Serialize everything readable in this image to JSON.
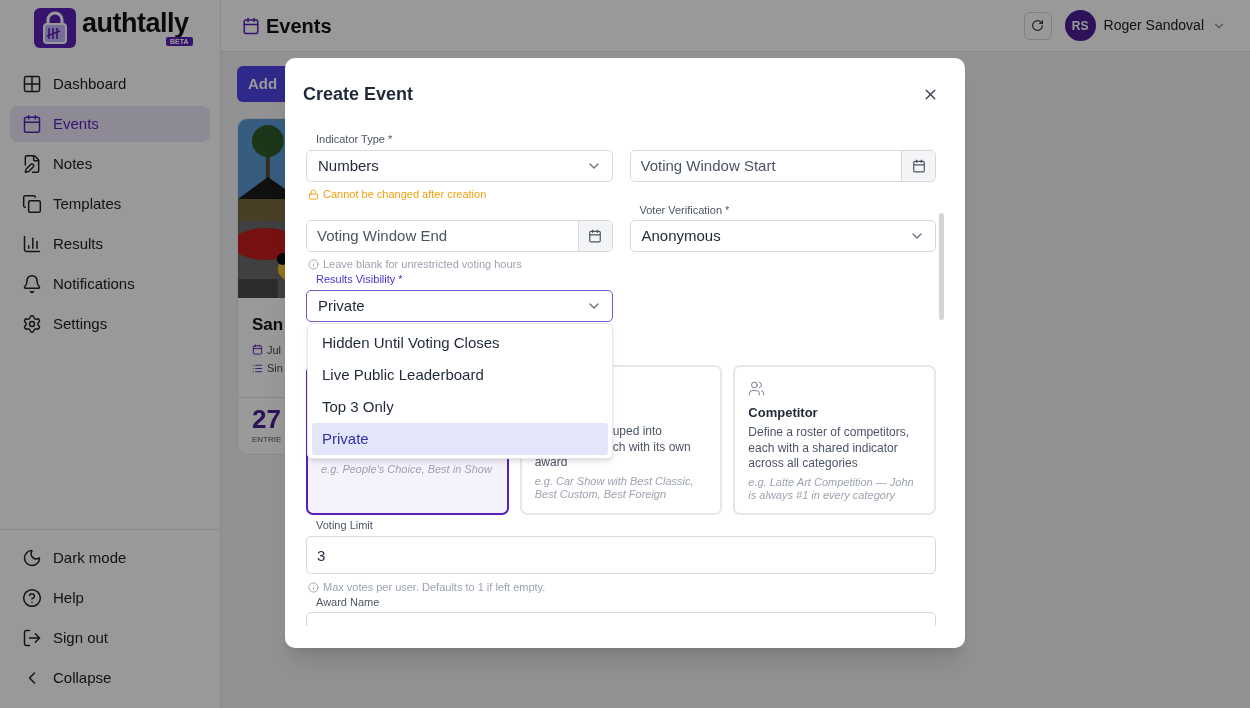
{
  "brand": {
    "name": "authtally",
    "badge": "BETA"
  },
  "nav": [
    {
      "label": "Dashboard",
      "selected": false
    },
    {
      "label": "Events",
      "selected": true
    },
    {
      "label": "Notes",
      "selected": false
    },
    {
      "label": "Templates",
      "selected": false
    },
    {
      "label": "Results",
      "selected": false
    },
    {
      "label": "Notifications",
      "selected": false
    },
    {
      "label": "Settings",
      "selected": false
    }
  ],
  "nav_bottom": [
    {
      "label": "Dark mode"
    },
    {
      "label": "Help"
    },
    {
      "label": "Sign out"
    },
    {
      "label": "Collapse"
    }
  ],
  "header": {
    "title": "Events",
    "user": {
      "initials": "RS",
      "name": "Roger Sandoval"
    }
  },
  "page": {
    "add_button": "Add",
    "event_card": {
      "title": "San",
      "date": "Jul",
      "type": "Sin",
      "count": "27",
      "count_label": "ENTRIE"
    }
  },
  "dialog": {
    "title": "Create Event",
    "indicator_type": {
      "label": "Indicator Type *",
      "value": "Numbers",
      "warning": "Cannot be changed after creation"
    },
    "voting_window_start": {
      "placeholder": "Voting Window Start"
    },
    "voting_window_end": {
      "placeholder": "Voting Window End",
      "help": "Leave blank for unrestricted voting hours"
    },
    "voter_verification": {
      "label": "Voter Verification *",
      "value": "Anonymous"
    },
    "results_visibility": {
      "label": "Results Visibility *",
      "value": "Private",
      "expanded": true,
      "options": [
        {
          "label": "Hidden Until Voting Closes",
          "selected": false
        },
        {
          "label": "Live Public Leaderboard",
          "selected": false
        },
        {
          "label": "Top 3 Only",
          "selected": false
        },
        {
          "label": "Private",
          "selected": true
        }
      ]
    },
    "modes": [
      {
        "selected": true,
        "example": "e.g. People's Choice, Best in Show"
      },
      {
        "selected": false,
        "description_lines": [
          {
            "text": "uped into",
            "kind": "cut"
          },
          {
            "text": "ch with its own",
            "kind": "cut"
          },
          {
            "text": "award",
            "kind": "full"
          }
        ],
        "example": "e.g. Car Show with Best Classic, Best Custom, Best Foreign"
      },
      {
        "selected": false,
        "title": "Competitor",
        "description": "Define a roster of competitors, each with a shared indicator across all categories",
        "example": "e.g. Latte Art Competition — John is always #1 in every category"
      }
    ],
    "voting_limit": {
      "label": "Voting Limit",
      "value": "3",
      "help": "Max votes per user. Defaults to 1 if left empty."
    },
    "award_name": {
      "label": "Award Name"
    }
  }
}
